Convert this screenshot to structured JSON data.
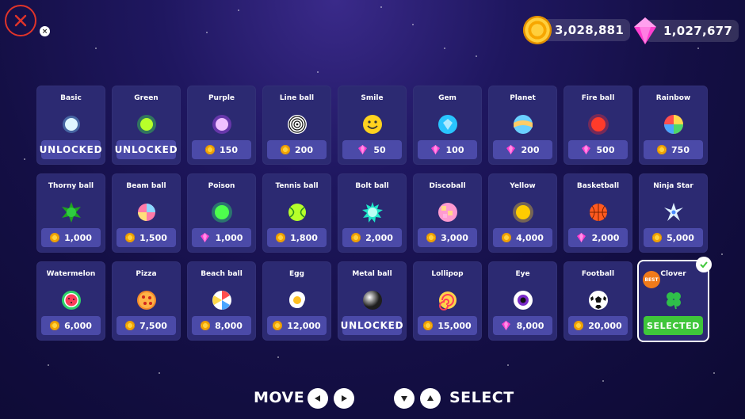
{
  "currency": {
    "coins": "3,028,881",
    "gems": "1,027,677"
  },
  "header": {
    "close_hint_key": "×"
  },
  "cards": [
    {
      "name": "Basic",
      "price": "UNLOCKED",
      "currency": "none",
      "ball": "basic"
    },
    {
      "name": "Green",
      "price": "UNLOCKED",
      "currency": "none",
      "ball": "green"
    },
    {
      "name": "Purple",
      "price": "150",
      "currency": "coin",
      "ball": "purple"
    },
    {
      "name": "Line ball",
      "price": "200",
      "currency": "coin",
      "ball": "line"
    },
    {
      "name": "Smile",
      "price": "50",
      "currency": "gem",
      "ball": "smile"
    },
    {
      "name": "Gem",
      "price": "100",
      "currency": "gem",
      "ball": "gem"
    },
    {
      "name": "Planet",
      "price": "200",
      "currency": "gem",
      "ball": "planet"
    },
    {
      "name": "Fire ball",
      "price": "500",
      "currency": "gem",
      "ball": "fire"
    },
    {
      "name": "Rainbow",
      "price": "750",
      "currency": "coin",
      "ball": "rainbow"
    },
    {
      "name": "Thorny ball",
      "price": "1,000",
      "currency": "coin",
      "ball": "thorny"
    },
    {
      "name": "Beam ball",
      "price": "1,500",
      "currency": "coin",
      "ball": "beam"
    },
    {
      "name": "Poison",
      "price": "1,000",
      "currency": "gem",
      "ball": "poison"
    },
    {
      "name": "Tennis ball",
      "price": "1,800",
      "currency": "coin",
      "ball": "tennis"
    },
    {
      "name": "Bolt ball",
      "price": "2,000",
      "currency": "coin",
      "ball": "bolt"
    },
    {
      "name": "Discoball",
      "price": "3,000",
      "currency": "coin",
      "ball": "disco"
    },
    {
      "name": "Yellow",
      "price": "4,000",
      "currency": "coin",
      "ball": "yellow"
    },
    {
      "name": "Basketball",
      "price": "2,000",
      "currency": "gem",
      "ball": "basketball"
    },
    {
      "name": "Ninja Star",
      "price": "5,000",
      "currency": "coin",
      "ball": "ninja"
    },
    {
      "name": "Watermelon",
      "price": "6,000",
      "currency": "coin",
      "ball": "watermelon"
    },
    {
      "name": "Pizza",
      "price": "7,500",
      "currency": "coin",
      "ball": "pizza"
    },
    {
      "name": "Beach ball",
      "price": "8,000",
      "currency": "coin",
      "ball": "beach"
    },
    {
      "name": "Egg",
      "price": "12,000",
      "currency": "coin",
      "ball": "egg"
    },
    {
      "name": "Metal ball",
      "price": "UNLOCKED",
      "currency": "none",
      "ball": "metal"
    },
    {
      "name": "Lollipop",
      "price": "15,000",
      "currency": "coin",
      "ball": "lollipop"
    },
    {
      "name": "Eye",
      "price": "8,000",
      "currency": "gem",
      "ball": "eye"
    },
    {
      "name": "Football",
      "price": "20,000",
      "currency": "coin",
      "ball": "football"
    },
    {
      "name": "Clover",
      "price": "SELECTED",
      "currency": "none",
      "ball": "clover",
      "selected": true,
      "badge": "BEST"
    }
  ],
  "footer": {
    "move_label": "MOVE",
    "select_label": "SELECT"
  },
  "colors": {
    "card_bg": "#2c2a72",
    "price_bg": "#4b4aa8",
    "selected_bg": "#3fc63a",
    "close_red": "#e0342a"
  }
}
